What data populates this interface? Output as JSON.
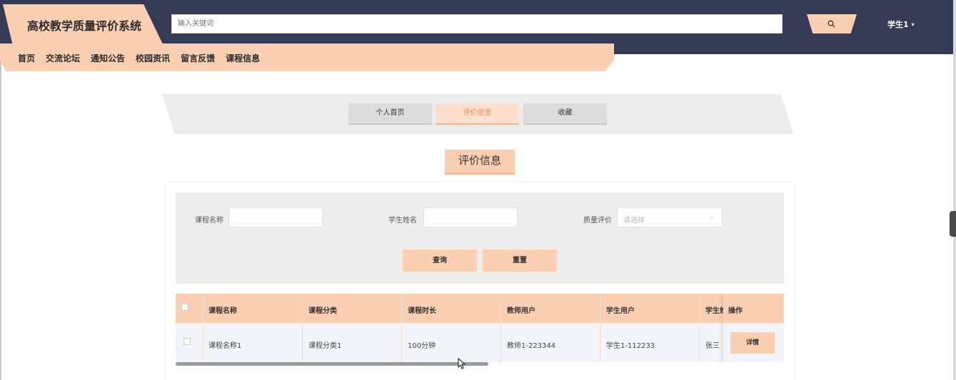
{
  "header": {
    "app_title": "高校教学质量评价系统",
    "search_placeholder": "输入关键词",
    "search_icon": "search-icon",
    "user_label": "学生1",
    "user_caret": "▾"
  },
  "nav": {
    "items": [
      "首页",
      "交流论坛",
      "通知公告",
      "校园资讯",
      "留言反馈",
      "课程信息"
    ]
  },
  "tabs": [
    {
      "label": "个人首页",
      "active": false
    },
    {
      "label": "评价信息",
      "active": true
    },
    {
      "label": "收藏",
      "active": false
    }
  ],
  "section_title": "评价信息",
  "filters": {
    "course_name_label": "课程名称",
    "course_name_value": "",
    "student_name_label": "学生姓名",
    "student_name_value": "",
    "quality_label": "质量评价",
    "quality_placeholder": "请选择",
    "search_button": "查询",
    "reset_button": "重置"
  },
  "table": {
    "columns": [
      "课程名称",
      "课程分类",
      "课程时长",
      "教师用户",
      "学生用户",
      "学生姓"
    ],
    "operation_header": "操作",
    "rows": [
      {
        "cells": [
          "课程名称1",
          "课程分类1",
          "100分钟",
          "教师1-223344",
          "学生1-112233",
          "张三"
        ],
        "action": "详情"
      }
    ]
  },
  "colors": {
    "topbar": "#353b55",
    "accent": "#fbcfb1",
    "accent_text": "#ee8a55"
  }
}
